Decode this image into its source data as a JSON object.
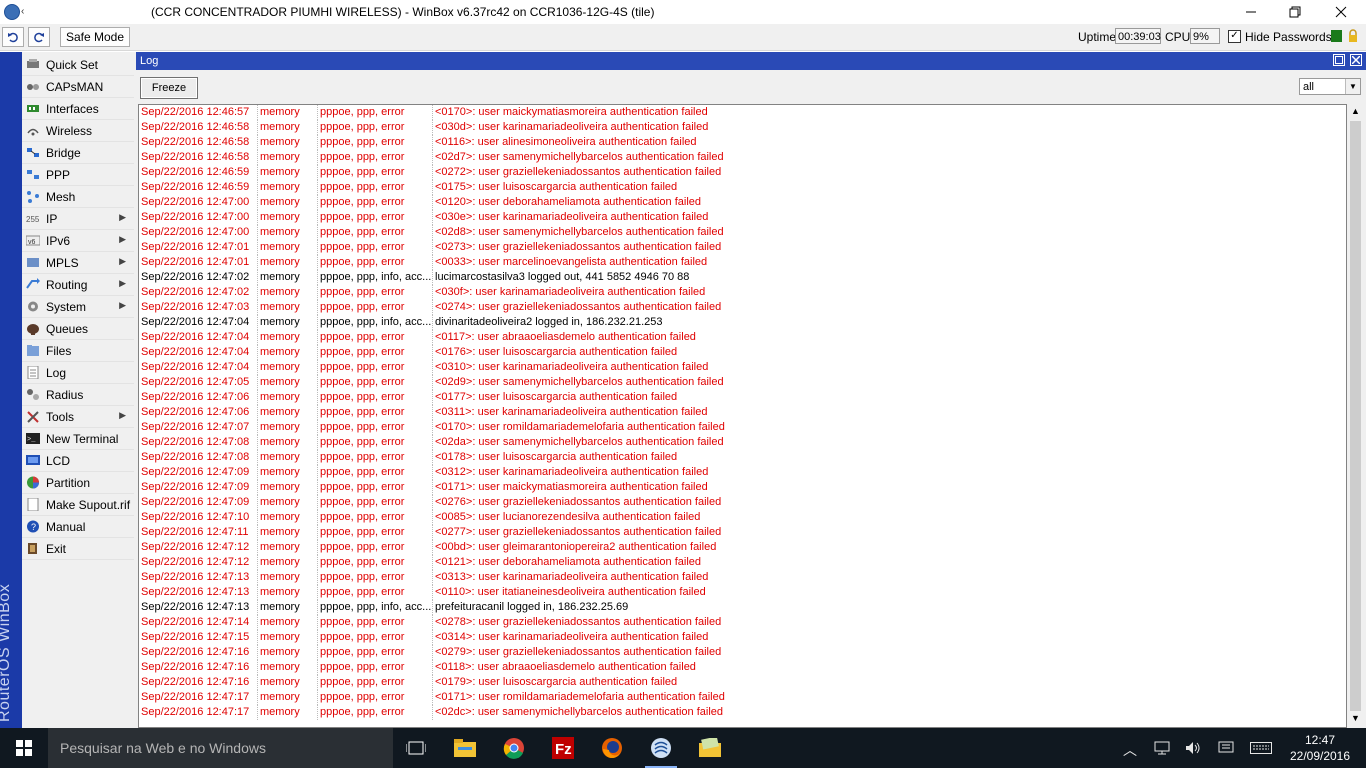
{
  "window": {
    "title": "(CCR CONCENTRADOR PIUMHI WIRELESS) - WinBox v6.37rc42 on CCR1036-12G-4S (tile)",
    "icon_suffix": "‹"
  },
  "toolbar": {
    "safe_mode_label": "Safe Mode",
    "uptime_label": "Uptime:",
    "uptime_value": "00:39:03",
    "cpu_label": "CPU:",
    "cpu_value": "9%",
    "hide_passwords_label": "Hide Passwords",
    "hide_passwords_checked": true
  },
  "brand_vertical": "RouterOS WinBox",
  "sidebar": {
    "items": [
      {
        "label": "Quick Set",
        "icon": "quickset-icon",
        "submenu": false
      },
      {
        "label": "CAPsMAN",
        "icon": "capsman-icon",
        "submenu": false
      },
      {
        "label": "Interfaces",
        "icon": "interfaces-icon",
        "submenu": false
      },
      {
        "label": "Wireless",
        "icon": "wireless-icon",
        "submenu": false
      },
      {
        "label": "Bridge",
        "icon": "bridge-icon",
        "submenu": false
      },
      {
        "label": "PPP",
        "icon": "ppp-icon",
        "submenu": false
      },
      {
        "label": "Mesh",
        "icon": "mesh-icon",
        "submenu": false
      },
      {
        "label": "IP",
        "icon": "ip-icon",
        "submenu": true
      },
      {
        "label": "IPv6",
        "icon": "ipv6-icon",
        "submenu": true
      },
      {
        "label": "MPLS",
        "icon": "mpls-icon",
        "submenu": true
      },
      {
        "label": "Routing",
        "icon": "routing-icon",
        "submenu": true
      },
      {
        "label": "System",
        "icon": "system-icon",
        "submenu": true
      },
      {
        "label": "Queues",
        "icon": "queues-icon",
        "submenu": false
      },
      {
        "label": "Files",
        "icon": "files-icon",
        "submenu": false
      },
      {
        "label": "Log",
        "icon": "log-icon",
        "submenu": false
      },
      {
        "label": "Radius",
        "icon": "radius-icon",
        "submenu": false
      },
      {
        "label": "Tools",
        "icon": "tools-icon",
        "submenu": true
      },
      {
        "label": "New Terminal",
        "icon": "terminal-icon",
        "submenu": false
      },
      {
        "label": "LCD",
        "icon": "lcd-icon",
        "submenu": false
      },
      {
        "label": "Partition",
        "icon": "partition-icon",
        "submenu": false
      },
      {
        "label": "Make Supout.rif",
        "icon": "supout-icon",
        "submenu": false
      },
      {
        "label": "Manual",
        "icon": "manual-icon",
        "submenu": false
      },
      {
        "label": "Exit",
        "icon": "exit-icon",
        "submenu": false
      }
    ]
  },
  "log_window": {
    "title": "Log",
    "freeze_label": "Freeze",
    "filter_value": "all",
    "colors": {
      "error": "#e00000",
      "info": "#000000"
    },
    "rows": [
      {
        "time": "Sep/22/2016 12:46:57",
        "buffer": "memory",
        "topics": "pppoe, ppp, error",
        "message": "<0170>: user maickymatiasmoreira authentication failed",
        "level": "err"
      },
      {
        "time": "Sep/22/2016 12:46:58",
        "buffer": "memory",
        "topics": "pppoe, ppp, error",
        "message": "<030d>: user karinamariadeoliveira authentication failed",
        "level": "err"
      },
      {
        "time": "Sep/22/2016 12:46:58",
        "buffer": "memory",
        "topics": "pppoe, ppp, error",
        "message": "<0116>: user alinesimoneoliveira authentication failed",
        "level": "err"
      },
      {
        "time": "Sep/22/2016 12:46:58",
        "buffer": "memory",
        "topics": "pppoe, ppp, error",
        "message": "<02d7>: user samenymichellybarcelos authentication failed",
        "level": "err"
      },
      {
        "time": "Sep/22/2016 12:46:59",
        "buffer": "memory",
        "topics": "pppoe, ppp, error",
        "message": "<0272>: user graziellekeniadossantos authentication failed",
        "level": "err"
      },
      {
        "time": "Sep/22/2016 12:46:59",
        "buffer": "memory",
        "topics": "pppoe, ppp, error",
        "message": "<0175>: user luisoscargarcia authentication failed",
        "level": "err"
      },
      {
        "time": "Sep/22/2016 12:47:00",
        "buffer": "memory",
        "topics": "pppoe, ppp, error",
        "message": "<0120>: user deborahameliamota authentication failed",
        "level": "err"
      },
      {
        "time": "Sep/22/2016 12:47:00",
        "buffer": "memory",
        "topics": "pppoe, ppp, error",
        "message": "<030e>: user karinamariadeoliveira authentication failed",
        "level": "err"
      },
      {
        "time": "Sep/22/2016 12:47:00",
        "buffer": "memory",
        "topics": "pppoe, ppp, error",
        "message": "<02d8>: user samenymichellybarcelos authentication failed",
        "level": "err"
      },
      {
        "time": "Sep/22/2016 12:47:01",
        "buffer": "memory",
        "topics": "pppoe, ppp, error",
        "message": "<0273>: user graziellekeniadossantos authentication failed",
        "level": "err"
      },
      {
        "time": "Sep/22/2016 12:47:01",
        "buffer": "memory",
        "topics": "pppoe, ppp, error",
        "message": "<0033>: user marcelinoevangelista authentication failed",
        "level": "err"
      },
      {
        "time": "Sep/22/2016 12:47:02",
        "buffer": "memory",
        "topics": "pppoe, ppp, info, acc...",
        "message": "lucimarcostasilva3 logged out, 441 5852 4946 70 88",
        "level": "info"
      },
      {
        "time": "Sep/22/2016 12:47:02",
        "buffer": "memory",
        "topics": "pppoe, ppp, error",
        "message": "<030f>: user karinamariadeoliveira authentication failed",
        "level": "err"
      },
      {
        "time": "Sep/22/2016 12:47:03",
        "buffer": "memory",
        "topics": "pppoe, ppp, error",
        "message": "<0274>: user graziellekeniadossantos authentication failed",
        "level": "err"
      },
      {
        "time": "Sep/22/2016 12:47:04",
        "buffer": "memory",
        "topics": "pppoe, ppp, info, acc...",
        "message": "divinaritadeoliveira2 logged in, 186.232.21.253",
        "level": "info"
      },
      {
        "time": "Sep/22/2016 12:47:04",
        "buffer": "memory",
        "topics": "pppoe, ppp, error",
        "message": "<0117>: user abraaoeliasdemelo authentication failed",
        "level": "err"
      },
      {
        "time": "Sep/22/2016 12:47:04",
        "buffer": "memory",
        "topics": "pppoe, ppp, error",
        "message": "<0176>: user luisoscargarcia authentication failed",
        "level": "err"
      },
      {
        "time": "Sep/22/2016 12:47:04",
        "buffer": "memory",
        "topics": "pppoe, ppp, error",
        "message": "<0310>: user karinamariadeoliveira authentication failed",
        "level": "err"
      },
      {
        "time": "Sep/22/2016 12:47:05",
        "buffer": "memory",
        "topics": "pppoe, ppp, error",
        "message": "<02d9>: user samenymichellybarcelos authentication failed",
        "level": "err"
      },
      {
        "time": "Sep/22/2016 12:47:06",
        "buffer": "memory",
        "topics": "pppoe, ppp, error",
        "message": "<0177>: user luisoscargarcia authentication failed",
        "level": "err"
      },
      {
        "time": "Sep/22/2016 12:47:06",
        "buffer": "memory",
        "topics": "pppoe, ppp, error",
        "message": "<0311>: user karinamariadeoliveira authentication failed",
        "level": "err"
      },
      {
        "time": "Sep/22/2016 12:47:07",
        "buffer": "memory",
        "topics": "pppoe, ppp, error",
        "message": "<0170>: user romildamariademelofaria authentication failed",
        "level": "err"
      },
      {
        "time": "Sep/22/2016 12:47:08",
        "buffer": "memory",
        "topics": "pppoe, ppp, error",
        "message": "<02da>: user samenymichellybarcelos authentication failed",
        "level": "err"
      },
      {
        "time": "Sep/22/2016 12:47:08",
        "buffer": "memory",
        "topics": "pppoe, ppp, error",
        "message": "<0178>: user luisoscargarcia authentication failed",
        "level": "err"
      },
      {
        "time": "Sep/22/2016 12:47:09",
        "buffer": "memory",
        "topics": "pppoe, ppp, error",
        "message": "<0312>: user karinamariadeoliveira authentication failed",
        "level": "err"
      },
      {
        "time": "Sep/22/2016 12:47:09",
        "buffer": "memory",
        "topics": "pppoe, ppp, error",
        "message": "<0171>: user maickymatiasmoreira authentication failed",
        "level": "err"
      },
      {
        "time": "Sep/22/2016 12:47:09",
        "buffer": "memory",
        "topics": "pppoe, ppp, error",
        "message": "<0276>: user graziellekeniadossantos authentication failed",
        "level": "err"
      },
      {
        "time": "Sep/22/2016 12:47:10",
        "buffer": "memory",
        "topics": "pppoe, ppp, error",
        "message": "<0085>: user lucianorezendesilva authentication failed",
        "level": "err"
      },
      {
        "time": "Sep/22/2016 12:47:11",
        "buffer": "memory",
        "topics": "pppoe, ppp, error",
        "message": "<0277>: user graziellekeniadossantos authentication failed",
        "level": "err"
      },
      {
        "time": "Sep/22/2016 12:47:12",
        "buffer": "memory",
        "topics": "pppoe, ppp, error",
        "message": "<00bd>: user gleimarantoniopereira2 authentication failed",
        "level": "err"
      },
      {
        "time": "Sep/22/2016 12:47:12",
        "buffer": "memory",
        "topics": "pppoe, ppp, error",
        "message": "<0121>: user deborahameliamota authentication failed",
        "level": "err"
      },
      {
        "time": "Sep/22/2016 12:47:13",
        "buffer": "memory",
        "topics": "pppoe, ppp, error",
        "message": "<0313>: user karinamariadeoliveira authentication failed",
        "level": "err"
      },
      {
        "time": "Sep/22/2016 12:47:13",
        "buffer": "memory",
        "topics": "pppoe, ppp, error",
        "message": "<0110>: user itatianeinesdeoliveira authentication failed",
        "level": "err"
      },
      {
        "time": "Sep/22/2016 12:47:13",
        "buffer": "memory",
        "topics": "pppoe, ppp, info, acc...",
        "message": "prefeituracanil logged in, 186.232.25.69",
        "level": "info"
      },
      {
        "time": "Sep/22/2016 12:47:14",
        "buffer": "memory",
        "topics": "pppoe, ppp, error",
        "message": "<0278>: user graziellekeniadossantos authentication failed",
        "level": "err"
      },
      {
        "time": "Sep/22/2016 12:47:15",
        "buffer": "memory",
        "topics": "pppoe, ppp, error",
        "message": "<0314>: user karinamariadeoliveira authentication failed",
        "level": "err"
      },
      {
        "time": "Sep/22/2016 12:47:16",
        "buffer": "memory",
        "topics": "pppoe, ppp, error",
        "message": "<0279>: user graziellekeniadossantos authentication failed",
        "level": "err"
      },
      {
        "time": "Sep/22/2016 12:47:16",
        "buffer": "memory",
        "topics": "pppoe, ppp, error",
        "message": "<0118>: user abraaoeliasdemelo authentication failed",
        "level": "err"
      },
      {
        "time": "Sep/22/2016 12:47:16",
        "buffer": "memory",
        "topics": "pppoe, ppp, error",
        "message": "<0179>: user luisoscargarcia authentication failed",
        "level": "err"
      },
      {
        "time": "Sep/22/2016 12:47:17",
        "buffer": "memory",
        "topics": "pppoe, ppp, error",
        "message": "<0171>: user romildamariademelofaria authentication failed",
        "level": "err"
      },
      {
        "time": "Sep/22/2016 12:47:17",
        "buffer": "memory",
        "topics": "pppoe, ppp, error",
        "message": "<02dc>: user samenymichellybarcelos authentication failed",
        "level": "err"
      }
    ]
  },
  "taskbar": {
    "search_placeholder": "Pesquisar na Web e no Windows",
    "apps": [
      "task-view-icon",
      "file-explorer-icon",
      "chrome-icon",
      "filezilla-icon",
      "firefox-icon",
      "winbox-icon",
      "folder-icon"
    ],
    "clock_time": "12:47",
    "clock_date": "22/09/2016"
  }
}
